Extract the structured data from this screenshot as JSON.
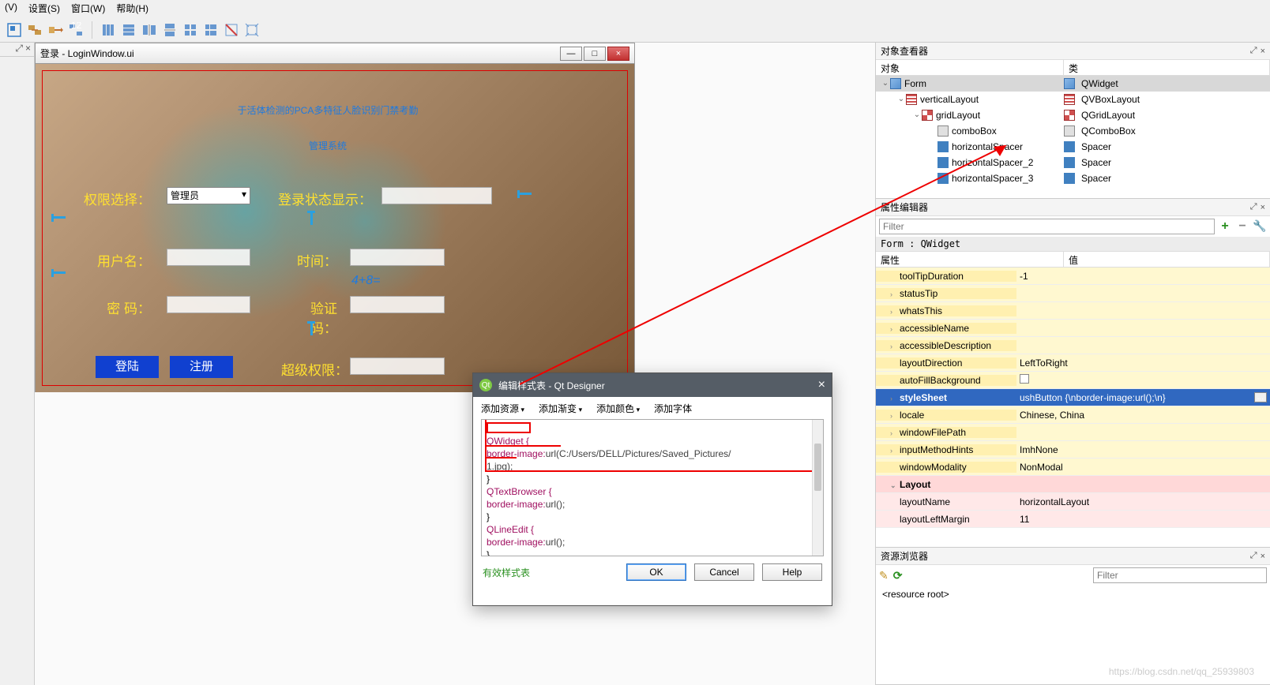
{
  "menubar": {
    "items": [
      "(V)",
      "设置(S)",
      "窗口(W)",
      "帮助(H)"
    ]
  },
  "leftdock": {
    "btn_float": "⤢",
    "btn_close": "×"
  },
  "formwin": {
    "title": "登录 - LoginWindow.ui",
    "win_min": "—",
    "win_max": "□",
    "win_close": "×",
    "bigtitle_l1": "于活体检测的PCA多特征人脸识别门禁考勤",
    "bigtitle_l2": "管理系统",
    "label_role": "权限选择：",
    "combo_role": "管理员",
    "label_loginstate": "登录状态显示：",
    "label_user": "用户名：",
    "label_time": "时间：",
    "captcha_expr": "4+8=",
    "label_pwd": "密  码：",
    "label_vcode": "验证码：",
    "btn_login": "登陆",
    "btn_register": "注册",
    "label_super": "超级权限："
  },
  "dlg": {
    "title": "编辑样式表 - Qt Designer",
    "close": "×",
    "toolbar": {
      "add_res": "添加资源",
      "add_grad": "添加渐变",
      "add_color": "添加颜色",
      "add_font": "添加字体"
    },
    "code_lines": [
      "QWidget {",
      "border-image:url(C:/Users/DELL/Pictures/Saved_Pictures/",
      "1.jpg);",
      "}",
      "QTextBrowser {",
      "border-image:url();",
      "}",
      "QLineEdit {",
      "border-image:url();",
      "}"
    ],
    "valid": "有效样式表",
    "ok": "OK",
    "cancel": "Cancel",
    "help": "Help"
  },
  "objinspector": {
    "title": "对象查看器",
    "hdr_obj": "对象",
    "hdr_class": "类",
    "rows": [
      {
        "indent": 0,
        "twist": "⌄",
        "name": "Form",
        "cls": "QWidget",
        "icon": "ico-form",
        "sel": true
      },
      {
        "indent": 1,
        "twist": "⌄",
        "name": "verticalLayout",
        "cls": "QVBoxLayout",
        "icon": "ico-vlayout"
      },
      {
        "indent": 2,
        "twist": "⌄",
        "name": "gridLayout",
        "cls": "QGridLayout",
        "icon": "ico-grid"
      },
      {
        "indent": 3,
        "twist": "",
        "name": "comboBox",
        "cls": "QComboBox",
        "icon": "ico-combo"
      },
      {
        "indent": 3,
        "twist": "",
        "name": "horizontalSpacer",
        "cls": "Spacer",
        "icon": "ico-spacer"
      },
      {
        "indent": 3,
        "twist": "",
        "name": "horizontalSpacer_2",
        "cls": "Spacer",
        "icon": "ico-spacer"
      },
      {
        "indent": 3,
        "twist": "",
        "name": "horizontalSpacer_3",
        "cls": "Spacer",
        "icon": "ico-spacer"
      }
    ]
  },
  "propeditor": {
    "title": "属性编辑器",
    "filter_ph": "Filter",
    "context": "Form : QWidget",
    "hdr_prop": "属性",
    "hdr_val": "值",
    "rows": [
      {
        "style": "y",
        "exp": "",
        "name": "toolTipDuration",
        "val": "-1"
      },
      {
        "style": "y",
        "exp": "›",
        "name": "statusTip",
        "val": ""
      },
      {
        "style": "y",
        "exp": "›",
        "name": "whatsThis",
        "val": ""
      },
      {
        "style": "y",
        "exp": "›",
        "name": "accessibleName",
        "val": ""
      },
      {
        "style": "y",
        "exp": "›",
        "name": "accessibleDescription",
        "val": ""
      },
      {
        "style": "y",
        "exp": "",
        "name": "layoutDirection",
        "val": "LeftToRight"
      },
      {
        "style": "y",
        "exp": "",
        "name": "autoFillBackground",
        "val": "",
        "chk": true
      },
      {
        "style": "b",
        "exp": "›",
        "name": "styleSheet",
        "val": "ushButton {\\nborder-image:url();\\n}",
        "more": true
      },
      {
        "style": "y",
        "exp": "›",
        "name": "locale",
        "val": "Chinese, China"
      },
      {
        "style": "y",
        "exp": "›",
        "name": "windowFilePath",
        "val": ""
      },
      {
        "style": "y",
        "exp": "›",
        "name": "inputMethodHints",
        "val": "ImhNone"
      },
      {
        "style": "y",
        "exp": "",
        "name": "windowModality",
        "val": "NonModal"
      },
      {
        "style": "p",
        "exp": "⌄",
        "name": "Layout",
        "val": ""
      },
      {
        "style": "pk",
        "exp": "",
        "name": "layoutName",
        "val": "horizontalLayout"
      },
      {
        "style": "pk",
        "exp": "",
        "name": "layoutLeftMargin",
        "val": "11"
      }
    ]
  },
  "resbrowser": {
    "title": "资源浏览器",
    "filter_ph": "Filter",
    "root": "<resource root>"
  },
  "watermark": "https://blog.csdn.net/qq_25939803"
}
